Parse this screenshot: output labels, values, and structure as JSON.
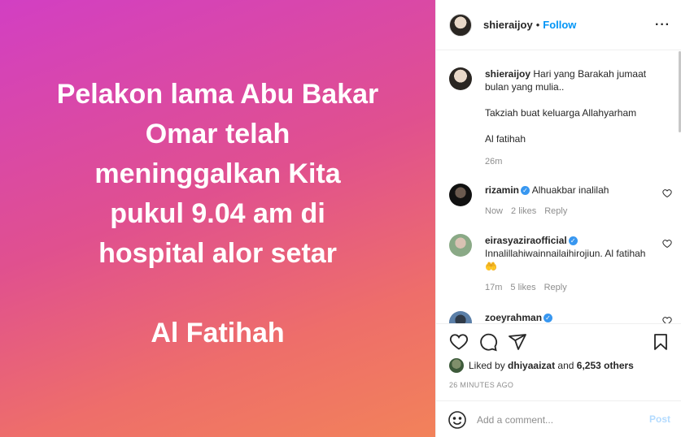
{
  "image": {
    "lines": [
      "Pelakon lama Abu Bakar",
      "Omar telah",
      "meninggalkan Kita",
      "pukul 9.04 am di",
      "hospital alor setar"
    ],
    "closing": "Al Fatihah"
  },
  "header": {
    "username": "shieraijoy",
    "separator": "•",
    "follow_label": "Follow",
    "more_icon": "···"
  },
  "caption": {
    "username": "shieraijoy",
    "line1": "Hari yang Barakah jumaat bulan yang mulia..",
    "line2": "Takziah buat keluarga Allahyarham",
    "line3": "Al fatihah",
    "time": "26m"
  },
  "comments": [
    {
      "username": "rizamin",
      "verified": true,
      "text": "Alhuakbar inalilah",
      "time": "Now",
      "likes": "2 likes",
      "reply": "Reply"
    },
    {
      "username": "eirasyaziraofficial",
      "verified": true,
      "text": "Innalillahiwainnailaihirojiun. Al fatihah 🤲",
      "time": "17m",
      "likes": "5 likes",
      "reply": "Reply"
    },
    {
      "username": "zoeyrahman",
      "verified": true
    }
  ],
  "likes": {
    "prefix": "Liked by",
    "user": "dhiyaaizat",
    "middle": "and",
    "others": "6,253 others"
  },
  "timestamp": "26 MINUTES AGO",
  "add_comment": {
    "placeholder": "Add a comment...",
    "post_label": "Post"
  },
  "colors": {
    "accent": "#0095f6",
    "post_disabled": "#b3dbff",
    "gradient_start": "#d23fc3",
    "gradient_end": "#f2825a"
  }
}
